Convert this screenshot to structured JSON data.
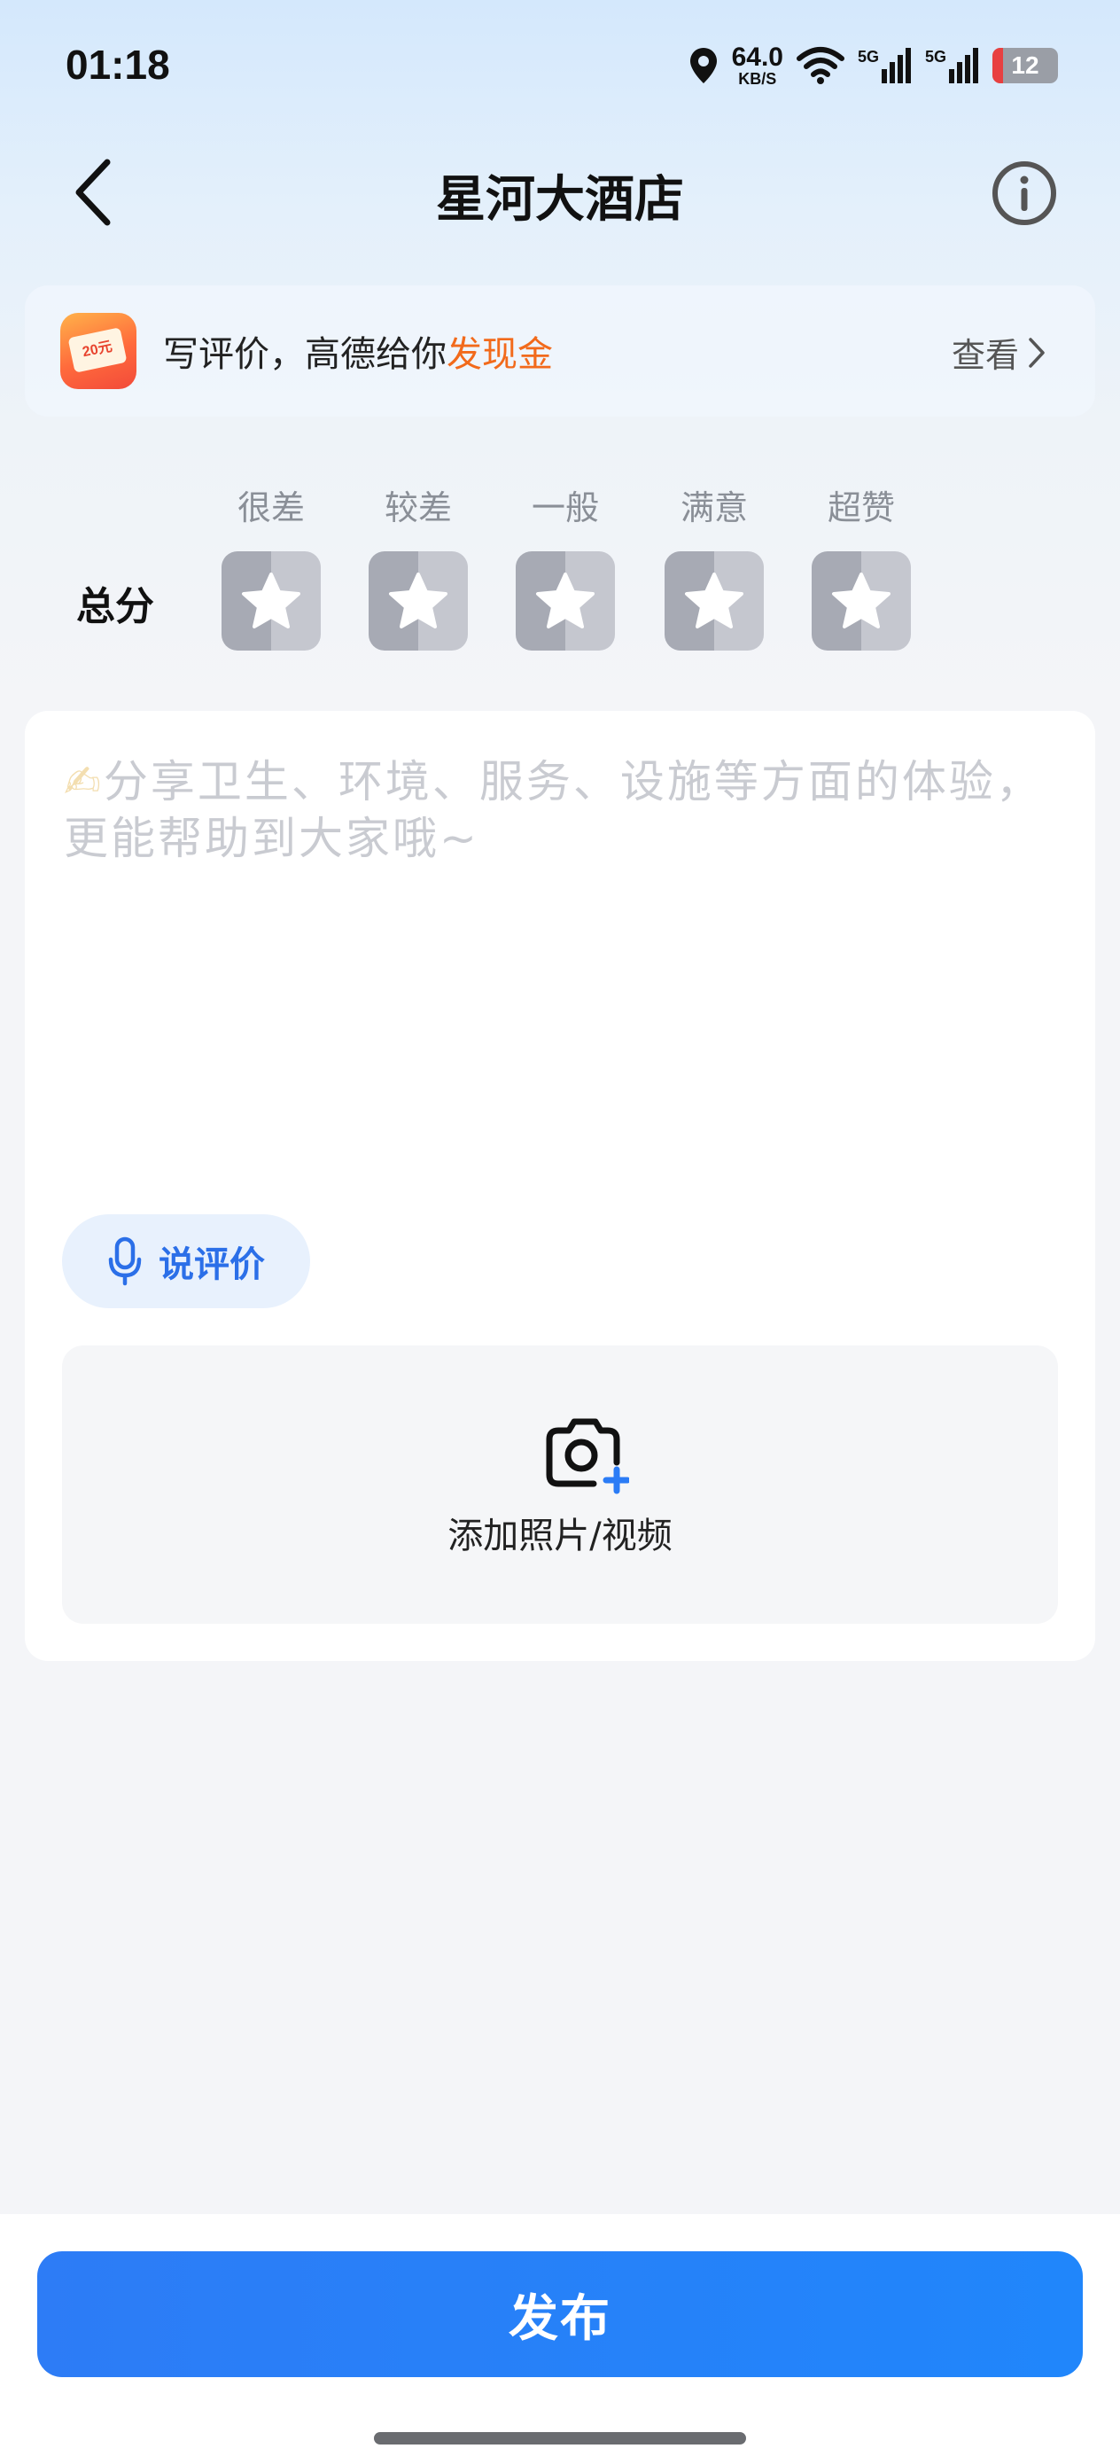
{
  "status_bar": {
    "time": "01:18",
    "net_speed_value": "64.0",
    "net_speed_unit": "KB/S",
    "signal1_label": "5G",
    "signal2_label": "5G",
    "battery": "12"
  },
  "nav": {
    "title": "星河大酒店"
  },
  "promo": {
    "ticket_text": "20元",
    "text_prefix": "写评价，高德给你",
    "text_highlight": "发现金",
    "link_label": "查看"
  },
  "rating": {
    "score_label": "总分",
    "levels": [
      "很差",
      "较差",
      "一般",
      "满意",
      "超赞"
    ],
    "value": 0,
    "max": 5
  },
  "review": {
    "placeholder_icon": "✍",
    "placeholder": "分享卫生、环境、服务、设施等方面的体验，更能帮助到大家哦~",
    "voice_label": "说评价",
    "media_label": "添加照片/视频"
  },
  "footer": {
    "publish_label": "发布"
  },
  "colors": {
    "accent": "#2086fb",
    "highlight": "#f26a1b",
    "voice_text": "#2b6fe8"
  }
}
